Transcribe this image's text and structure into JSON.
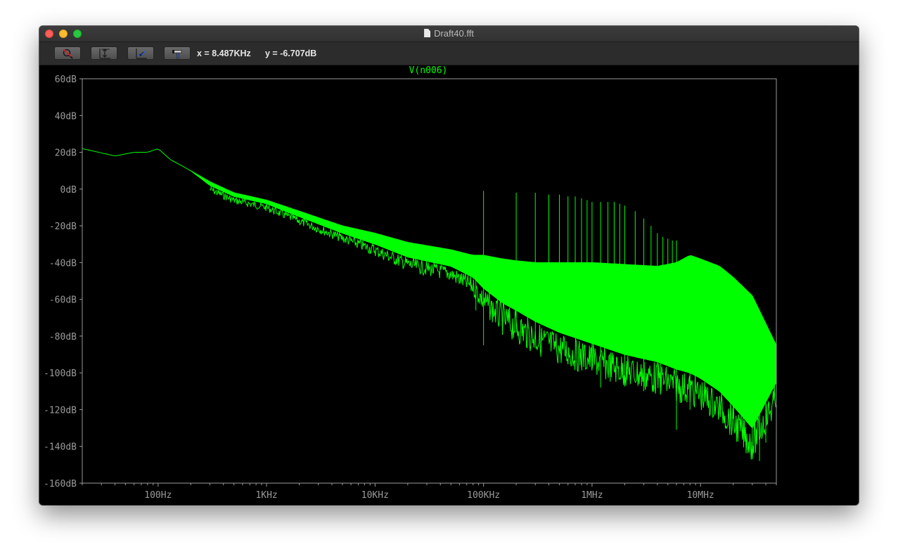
{
  "window": {
    "title": "Draft40.fft"
  },
  "toolbar": {
    "buttons": [
      {
        "name": "zoom-cancel-button",
        "icon": "magnifier-cancel-icon"
      },
      {
        "name": "autorange-y-button",
        "icon": "autorange-icon"
      },
      {
        "name": "zoom-full-button",
        "icon": "zoom-full-icon"
      },
      {
        "name": "cursor-button",
        "icon": "hammer-icon"
      }
    ],
    "cursor_x": "x = 8.487KHz",
    "cursor_y": "y = -6.707dB"
  },
  "colors": {
    "trace": "#00ff00",
    "axis": "#9a9a9a",
    "background": "#000000"
  },
  "chart_data": {
    "type": "line",
    "title": "V(n006)",
    "xscale": "log",
    "xlim": [
      20,
      50000000
    ],
    "ylim": [
      -160,
      60
    ],
    "x_ticks": [
      {
        "value": 100,
        "label": "100Hz"
      },
      {
        "value": 1000,
        "label": "1KHz"
      },
      {
        "value": 10000,
        "label": "10KHz"
      },
      {
        "value": 100000,
        "label": "100KHz"
      },
      {
        "value": 1000000,
        "label": "1MHz"
      },
      {
        "value": 10000000,
        "label": "10MHz"
      }
    ],
    "y_ticks": [
      {
        "value": 60,
        "label": "60dB"
      },
      {
        "value": 40,
        "label": "40dB"
      },
      {
        "value": 20,
        "label": "20dB"
      },
      {
        "value": 0,
        "label": "0dB"
      },
      {
        "value": -20,
        "label": "-20dB"
      },
      {
        "value": -40,
        "label": "-40dB"
      },
      {
        "value": -60,
        "label": "-60dB"
      },
      {
        "value": -80,
        "label": "-80dB"
      },
      {
        "value": -100,
        "label": "-100dB"
      },
      {
        "value": -120,
        "label": "-120dB"
      },
      {
        "value": -140,
        "label": "-140dB"
      },
      {
        "value": -160,
        "label": "-160dB"
      }
    ],
    "grid": false,
    "series": [
      {
        "name": "V(n006)",
        "upper": {
          "x": [
            20,
            40,
            60,
            80,
            100,
            130,
            200,
            300,
            500,
            1000,
            2000,
            5000,
            10000,
            20000,
            50000,
            80000,
            100000,
            150000,
            200000,
            300000,
            500000,
            1000000,
            2000000,
            4000000,
            6000000,
            8000000,
            10000000,
            15000000,
            20000000,
            30000000,
            50000000
          ],
          "y": [
            22,
            18,
            20,
            20,
            22,
            16,
            10,
            4,
            -2,
            -6,
            -12,
            -20,
            -24,
            -29,
            -33,
            -36,
            -36,
            -38,
            -39,
            -40,
            -40,
            -40,
            -41,
            -42,
            -40,
            -36,
            -38,
            -42,
            -48,
            -58,
            -85
          ]
        },
        "lower": {
          "x": [
            20,
            40,
            60,
            80,
            100,
            130,
            200,
            300,
            500,
            1000,
            2000,
            5000,
            10000,
            20000,
            50000,
            80000,
            100000,
            150000,
            200000,
            300000,
            500000,
            1000000,
            2000000,
            4000000,
            6000000,
            8000000,
            10000000,
            15000000,
            20000000,
            30000000,
            50000000
          ],
          "y": [
            22,
            18,
            20,
            20,
            22,
            16,
            10,
            2,
            -4,
            -8,
            -15,
            -24,
            -30,
            -37,
            -42,
            -48,
            -54,
            -62,
            -66,
            -72,
            -78,
            -84,
            -90,
            -94,
            -98,
            -100,
            -103,
            -110,
            -118,
            -130,
            -105
          ]
        },
        "spikes": [
          {
            "x": 100000,
            "y": -1
          },
          {
            "x": 200000,
            "y": -2
          },
          {
            "x": 300000,
            "y": -2
          },
          {
            "x": 400000,
            "y": -3
          },
          {
            "x": 500000,
            "y": -3
          },
          {
            "x": 600000,
            "y": -4
          },
          {
            "x": 700000,
            "y": -4
          },
          {
            "x": 800000,
            "y": -5
          },
          {
            "x": 900000,
            "y": -6
          },
          {
            "x": 1000000,
            "y": -7
          },
          {
            "x": 1200000,
            "y": -7
          },
          {
            "x": 1400000,
            "y": -7
          },
          {
            "x": 1600000,
            "y": -7
          },
          {
            "x": 1800000,
            "y": -8
          },
          {
            "x": 2000000,
            "y": -9
          },
          {
            "x": 2500000,
            "y": -12
          },
          {
            "x": 3000000,
            "y": -16
          },
          {
            "x": 3500000,
            "y": -20
          },
          {
            "x": 4000000,
            "y": -24
          },
          {
            "x": 4500000,
            "y": -26
          },
          {
            "x": 5000000,
            "y": -27
          },
          {
            "x": 5500000,
            "y": -28
          },
          {
            "x": 6000000,
            "y": -28
          }
        ],
        "dips": [
          {
            "x": 100000,
            "y": -85
          },
          {
            "x": 85000,
            "y": -66
          },
          {
            "x": 200000,
            "y": -78
          },
          {
            "x": 300000,
            "y": -80
          },
          {
            "x": 1000000,
            "y": -97
          },
          {
            "x": 1200000,
            "y": -108
          },
          {
            "x": 2000000,
            "y": -104
          },
          {
            "x": 3000000,
            "y": -110
          },
          {
            "x": 4300000,
            "y": -108
          },
          {
            "x": 6000000,
            "y": -131
          },
          {
            "x": 8000000,
            "y": -120
          },
          {
            "x": 20000000,
            "y": -125
          },
          {
            "x": 30000000,
            "y": -140
          },
          {
            "x": 35000000,
            "y": -148
          },
          {
            "x": 40000000,
            "y": -138
          }
        ]
      }
    ]
  }
}
